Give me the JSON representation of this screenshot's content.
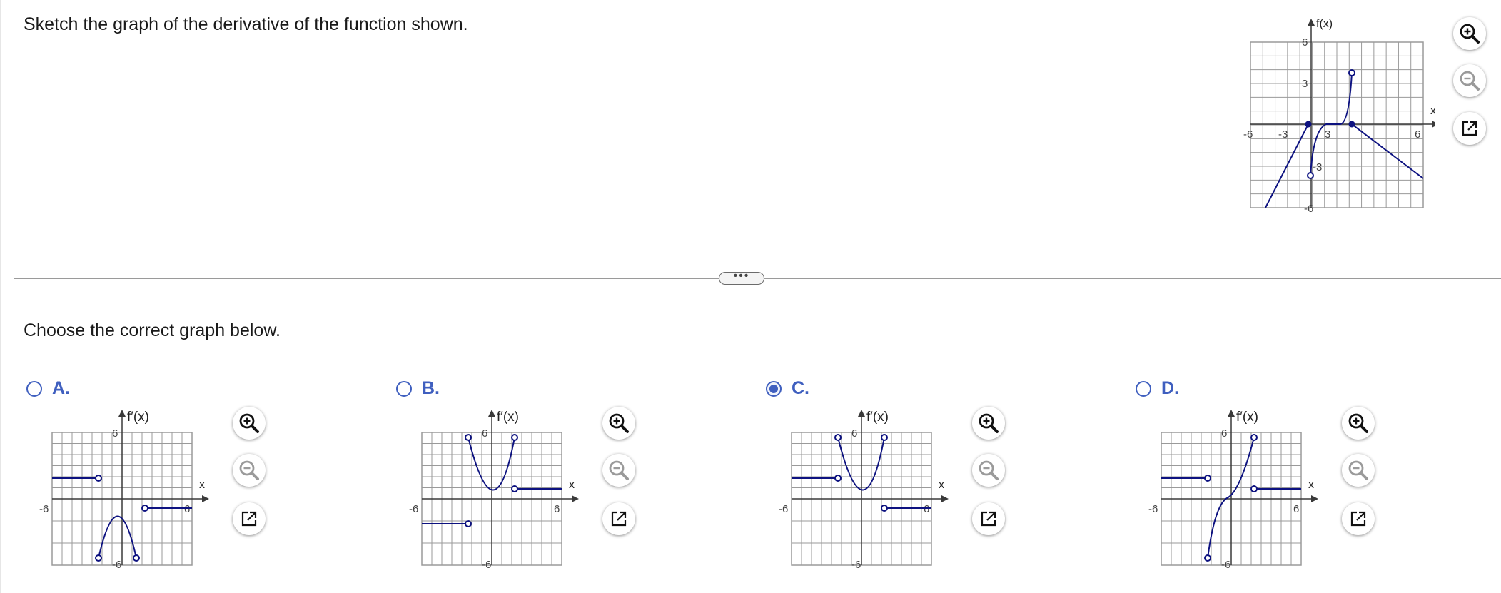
{
  "question": "Sketch the graph of the derivative of the function shown.",
  "prompt": "Choose the correct graph below.",
  "main_graph": {
    "ylabel": "f(x)",
    "xlabel": "x",
    "tick_neg6": "-6",
    "tick_neg3": "-3",
    "tick_pos3": "3",
    "tick_pos6": "6"
  },
  "options": [
    {
      "letter": "A.",
      "ylabel": "f′(x)",
      "xlabel": "x",
      "tick_top": "6",
      "tick_left": "-6",
      "tick_right": "6",
      "tick_bottom": "-6",
      "selected": false
    },
    {
      "letter": "B.",
      "ylabel": "f′(x)",
      "xlabel": "x",
      "tick_top": "6",
      "tick_left": "-6",
      "tick_right": "6",
      "tick_bottom": "-6",
      "selected": false
    },
    {
      "letter": "C.",
      "ylabel": "f′(x)",
      "xlabel": "x",
      "tick_top": "6",
      "tick_left": "-6",
      "tick_right": "6",
      "tick_bottom": "-6",
      "selected": true
    },
    {
      "letter": "D.",
      "ylabel": "f′(x)",
      "xlabel": "x",
      "tick_top": "6",
      "tick_left": "-6",
      "tick_right": "6",
      "tick_bottom": "-6",
      "selected": false
    }
  ],
  "tools": [
    "zoom-in-icon",
    "zoom-out-icon",
    "open-external-icon"
  ],
  "expander_label": "•••",
  "colors": {
    "curve": "#0d1280",
    "grid": "#9a9a9a",
    "axis": "#3a3a3a",
    "accent": "#3f5fbf"
  }
}
